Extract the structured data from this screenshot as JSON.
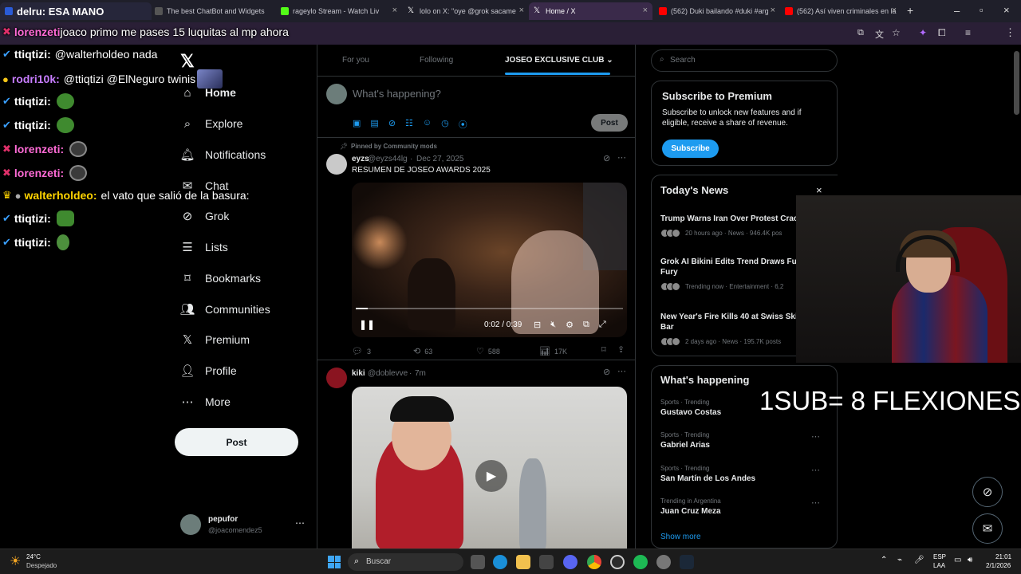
{
  "browser": {
    "tabs": [
      {
        "label": "delru: ESA MANO",
        "color": "#2a5bd7"
      },
      {
        "label": "The best ChatBot and Widgets",
        "color": "#666"
      },
      {
        "label": "rageylo Stream - Watch Liv",
        "color": "#53fc18"
      },
      {
        "label": "lolo on X: \"oye @grok sacame",
        "color": "#ffffff"
      },
      {
        "label": "Home / X",
        "color": "#ffffff"
      },
      {
        "label": "(562) Duki bailando #duki #arg",
        "color": "#ff0000"
      },
      {
        "label": "(562) Así viven criminales en la",
        "color": "#ff0000"
      }
    ],
    "address": "joaco primo me pases 15 luquitas al mp ahora"
  },
  "chat": [
    {
      "user": "lorenzeti",
      "msg": "joaco primo me pases 15 luquitas al mp ahora",
      "badge": "✖",
      "user_color": "#ff6bd6",
      "badge_color": "#e0306a"
    },
    {
      "user": "ttiqtizi",
      "msg": "@walterholdeo nada",
      "badge": "✔",
      "user_color": "#ffffff",
      "badge_color": "#3aa0ff"
    },
    {
      "user": "rodri10k",
      "msg": "@ttiqtizi @ElNeguro twinis",
      "badge": "●",
      "user_color": "#c77dff",
      "badge_color": "#f5c518"
    },
    {
      "user": "ttiqtizi",
      "msg": "",
      "badge": "✔",
      "user_color": "#ffffff",
      "badge_color": "#3aa0ff"
    },
    {
      "user": "ttiqtizi",
      "msg": "",
      "badge": "✔",
      "user_color": "#ffffff",
      "badge_color": "#3aa0ff"
    },
    {
      "user": "lorenzeti",
      "msg": "",
      "badge": "✖",
      "user_color": "#ff6bd6",
      "badge_color": "#e0306a"
    },
    {
      "user": "lorenzeti",
      "msg": "",
      "badge": "✖",
      "user_color": "#ff6bd6",
      "badge_color": "#e0306a"
    },
    {
      "user": "walterholdeo",
      "msg": "el vato que salió de la basura:",
      "badge": "♛",
      "user_color": "#ffd400",
      "badge_color": "#ffd400"
    },
    {
      "user": "ttiqtizi",
      "msg": "",
      "badge": "✔",
      "user_color": "#ffffff",
      "badge_color": "#3aa0ff"
    },
    {
      "user": "ttiqtizi",
      "msg": "",
      "badge": "✔",
      "user_color": "#ffffff",
      "badge_color": "#3aa0ff"
    }
  ],
  "nav": {
    "items": [
      {
        "label": "Home",
        "icon": "home-icon"
      },
      {
        "label": "Explore",
        "icon": "search-icon"
      },
      {
        "label": "Notifications",
        "icon": "bell-icon"
      },
      {
        "label": "Chat",
        "icon": "mail-icon"
      },
      {
        "label": "Grok",
        "icon": "grok-icon"
      },
      {
        "label": "Lists",
        "icon": "list-icon"
      },
      {
        "label": "Bookmarks",
        "icon": "bookmark-icon"
      },
      {
        "label": "Communities",
        "icon": "people-icon"
      },
      {
        "label": "Premium",
        "icon": "x-icon"
      },
      {
        "label": "Profile",
        "icon": "person-icon"
      },
      {
        "label": "More",
        "icon": "more-icon"
      }
    ],
    "post_button": "Post",
    "account": {
      "name": "pepufor",
      "handle": "@joacomendez5"
    }
  },
  "timeline": {
    "tabs": [
      "For you",
      "Following",
      "JOSEO EXCLUSIVE CLUB"
    ],
    "compose_placeholder": "What's happening?",
    "post_button": "Post",
    "pinned_label": "Pinned by Community mods",
    "tweet1": {
      "name": "eyzs",
      "handle": "@eyzs44lg",
      "date": "Dec 27, 2025",
      "text": "RESUMEN DE JOSEO AWARDS 2025",
      "video_time": "0:02 / 0:39",
      "replies": "3",
      "reposts": "63",
      "likes": "588",
      "views": "17K"
    },
    "tweet2": {
      "name": "kiki",
      "handle": "@doblevve",
      "date": "7m"
    }
  },
  "sidebar": {
    "search_placeholder": "Search",
    "premium": {
      "title": "Subscribe to Premium",
      "text": "Subscribe to unlock new features and if eligible, receive a share of revenue.",
      "button": "Subscribe"
    },
    "news": {
      "title": "Today's News",
      "items": [
        {
          "headline": "Trump Warns Iran Over Protest Crac",
          "meta": "20 hours ago · News · 946.4K pos"
        },
        {
          "headline": "Grok AI Bikini Edits Trend Draws Fur",
          "headline2": "Fury",
          "meta": "Trending now · Entertainment · 6,2"
        },
        {
          "headline": "New Year's Fire Kills 40 at Swiss Ski",
          "headline2": "Bar",
          "meta": "2 days ago · News · 195.7K posts"
        }
      ]
    },
    "happening": {
      "title": "What's happening",
      "trends": [
        {
          "category": "Sports · Trending",
          "name": "Gustavo Costas"
        },
        {
          "category": "Sports · Trending",
          "name": "Gabriel Arias"
        },
        {
          "category": "Sports · Trending",
          "name": "San Martín de Los Andes"
        },
        {
          "category": "Trending in Argentina",
          "name": "Juan Cruz Meza"
        }
      ],
      "show_more": "Show more"
    }
  },
  "overlay_text": "1SUB= 8 FLEXIONES",
  "taskbar": {
    "weather_temp": "24°C",
    "weather_desc": "Despejado",
    "search": "Buscar",
    "lang1": "ESP",
    "lang2": "LAA",
    "time": "21:01",
    "date": "2/1/2026"
  }
}
